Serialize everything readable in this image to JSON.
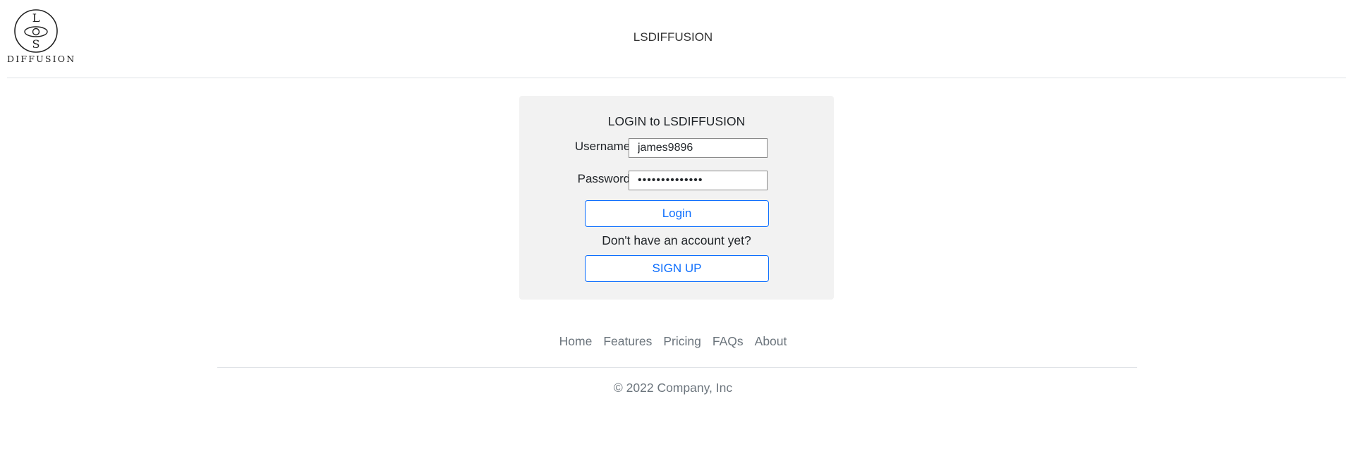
{
  "header": {
    "logo": {
      "letters": [
        "L",
        "S"
      ],
      "word": "DIFFUSION"
    },
    "site_title": "LSDIFFUSION"
  },
  "login": {
    "title": "LOGIN to LSDIFFUSION",
    "username_label": "Username:",
    "username_value": "james9896",
    "password_label": "Password:",
    "password_value": "••••••••••••••",
    "login_button": "Login",
    "signup_prompt": "Don't have an account yet?",
    "signup_button": "SIGN UP"
  },
  "footer": {
    "nav": [
      {
        "label": "Home"
      },
      {
        "label": "Features"
      },
      {
        "label": "Pricing"
      },
      {
        "label": "FAQs"
      },
      {
        "label": "About"
      }
    ],
    "copyright": "© 2022 Company, Inc"
  },
  "colors": {
    "accent": "#0d6efd",
    "card_background": "#f2f2f2",
    "muted_text": "#6c757d"
  }
}
